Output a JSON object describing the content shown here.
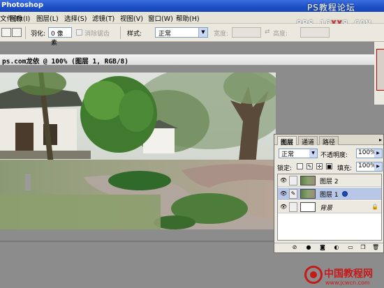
{
  "app": {
    "title": "Photoshop",
    "watermark_top": "PS教程论坛",
    "watermark_url_pre": "BBS.16",
    "watermark_url_xx": "XX",
    "watermark_url_post": "8.COM"
  },
  "menu": {
    "items": [
      "文件(F)",
      "图像(I)",
      "图层(L)",
      "选择(S)",
      "滤镜(T)",
      "视图(V)",
      "窗口(W)",
      "帮助(H)"
    ]
  },
  "options": {
    "feather_label": "羽化:",
    "feather_value": "0 像素",
    "antialias_label": "消除锯齿",
    "style_label": "样式:",
    "style_value": "正常",
    "width_label": "宽度:",
    "height_label": "高度:"
  },
  "document": {
    "title": "ps.com龙依 @ 100% (图层 1, RGB/8)"
  },
  "layers_panel": {
    "tabs": [
      "图层",
      "通道",
      "路径"
    ],
    "blend_mode": "正常",
    "opacity_label": "不透明度:",
    "opacity_value": "100%",
    "lock_label": "锁定:",
    "fill_label": "填充:",
    "fill_value": "100%",
    "layers": [
      {
        "name": "图层 2",
        "selected": false,
        "italic": false
      },
      {
        "name": "图层 1",
        "selected": true,
        "italic": false
      },
      {
        "name": "背景",
        "selected": false,
        "italic": true
      }
    ]
  },
  "footer": {
    "logo_text": "中国教程网",
    "logo_url": "www.jcwcn.com"
  },
  "colors": {
    "titlebar": "#1c4fc4",
    "selected_layer": "#b9c7e6",
    "logo_red": "#c51a1a"
  }
}
